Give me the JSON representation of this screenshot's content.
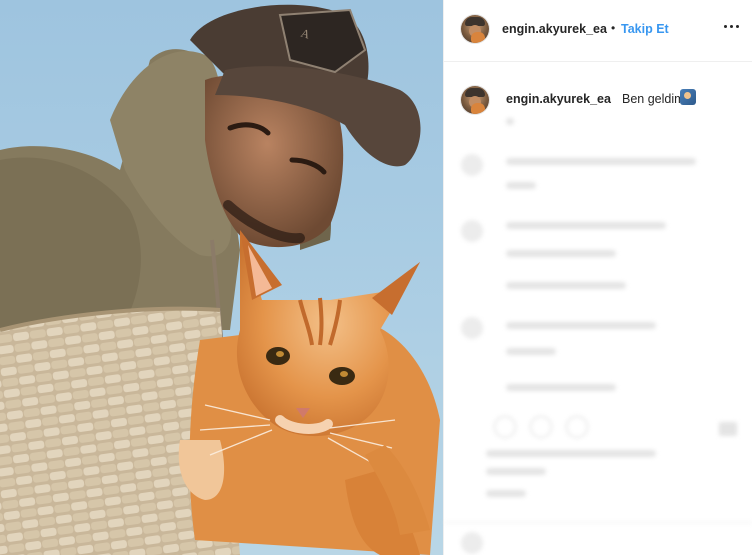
{
  "post": {
    "username": "engin.akyurek_ea",
    "separator": "•",
    "follow_label": "Takip Et",
    "caption_text": "Ben geldim",
    "caption_emoji_icon": "person-in-frame-emoji-icon",
    "more_icon": "more-options-icon"
  },
  "colors": {
    "accent": "#3897f0",
    "text": "#262626",
    "divider": "#efefef"
  }
}
